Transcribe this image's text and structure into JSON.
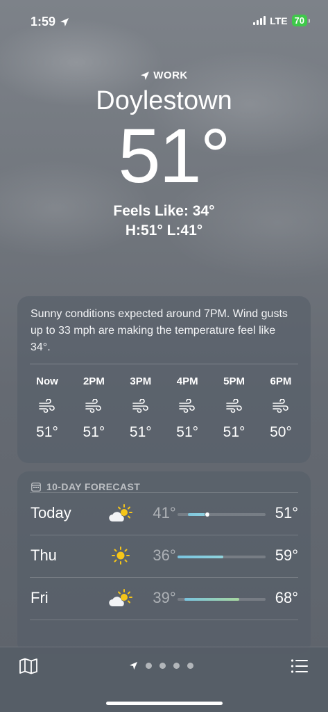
{
  "status_bar": {
    "time": "1:59",
    "network": "LTE",
    "battery": "70"
  },
  "location": {
    "label": "WORK",
    "city": "Doylestown",
    "temperature": "51°",
    "feels_like": "Feels Like: 34°",
    "high_low": "H:51°  L:41°"
  },
  "hourly": {
    "summary": "Sunny conditions expected around 7PM. Wind gusts up to 33 mph are making the temperature feel like 34°.",
    "hours": [
      {
        "label": "Now",
        "icon": "wind-icon",
        "temp": "51°"
      },
      {
        "label": "2PM",
        "icon": "wind-icon",
        "temp": "51°"
      },
      {
        "label": "3PM",
        "icon": "wind-icon",
        "temp": "51°"
      },
      {
        "label": "4PM",
        "icon": "wind-icon",
        "temp": "51°"
      },
      {
        "label": "5PM",
        "icon": "wind-icon",
        "temp": "51°"
      },
      {
        "label": "6PM",
        "icon": "wind-icon",
        "temp": "50°"
      }
    ]
  },
  "forecast": {
    "title": "10-DAY FORECAST",
    "days": [
      {
        "day": "Today",
        "icon": "partly-sunny-icon",
        "low": "41°",
        "high": "51°",
        "range_start": 0.12,
        "range_end": 0.34,
        "current": 0.34,
        "colors": [
          "#7fc6dd",
          "#8fd0de"
        ]
      },
      {
        "day": "Thu",
        "icon": "sun-icon",
        "low": "36°",
        "high": "59°",
        "range_start": 0.0,
        "range_end": 0.52,
        "colors": [
          "#79c4e0",
          "#8fd3dc"
        ]
      },
      {
        "day": "Fri",
        "icon": "partly-sunny-icon",
        "low": "39°",
        "high": "68°",
        "range_start": 0.08,
        "range_end": 0.7,
        "colors": [
          "#79c4e0",
          "#a7d7a0"
        ]
      }
    ]
  },
  "bottom_bar": {
    "page_count": 4
  }
}
